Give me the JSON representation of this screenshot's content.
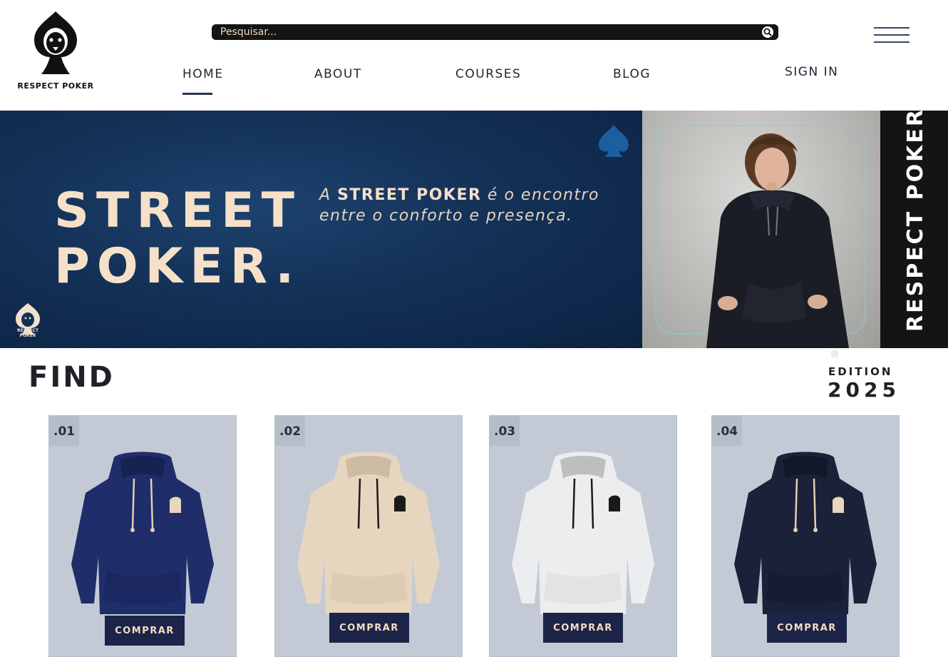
{
  "header": {
    "logo_text": "RESPECT POKER",
    "search": {
      "placeholder": "Pesquisar..."
    },
    "nav": [
      {
        "label": "HOME",
        "active": true
      },
      {
        "label": "ABOUT"
      },
      {
        "label": "COURSES"
      },
      {
        "label": "BLOG"
      },
      {
        "label": "SIGN IN"
      }
    ],
    "icons": {
      "search": "search-icon",
      "menu": "hamburger-menu-icon"
    }
  },
  "banner": {
    "headline_line1": "STREET",
    "headline_line2": "POKER.",
    "tagline_prefix": "A",
    "tagline_brand": "STREET POKER",
    "tagline_rest": "é o encontro entre o conforto e presença.",
    "side_text": "RESPECT POKER",
    "small_logo_text": "RESPECT POKER",
    "colors": {
      "background": "#123056",
      "headline": "#f6e0c8",
      "side_panel": "#141414"
    }
  },
  "section": {
    "title": "FIND",
    "edition_label": "EDITION",
    "edition_year": "2025"
  },
  "products": [
    {
      "number": ".01",
      "button": "COMPRAR",
      "color": "#1f2d6a"
    },
    {
      "number": ".02",
      "button": "COMPRAR",
      "color": "#e6d6c0"
    },
    {
      "number": ".03",
      "button": "COMPRAR",
      "color": "#ecedee"
    },
    {
      "number": ".04",
      "button": "COMPRAR",
      "color": "#1a2138"
    }
  ]
}
